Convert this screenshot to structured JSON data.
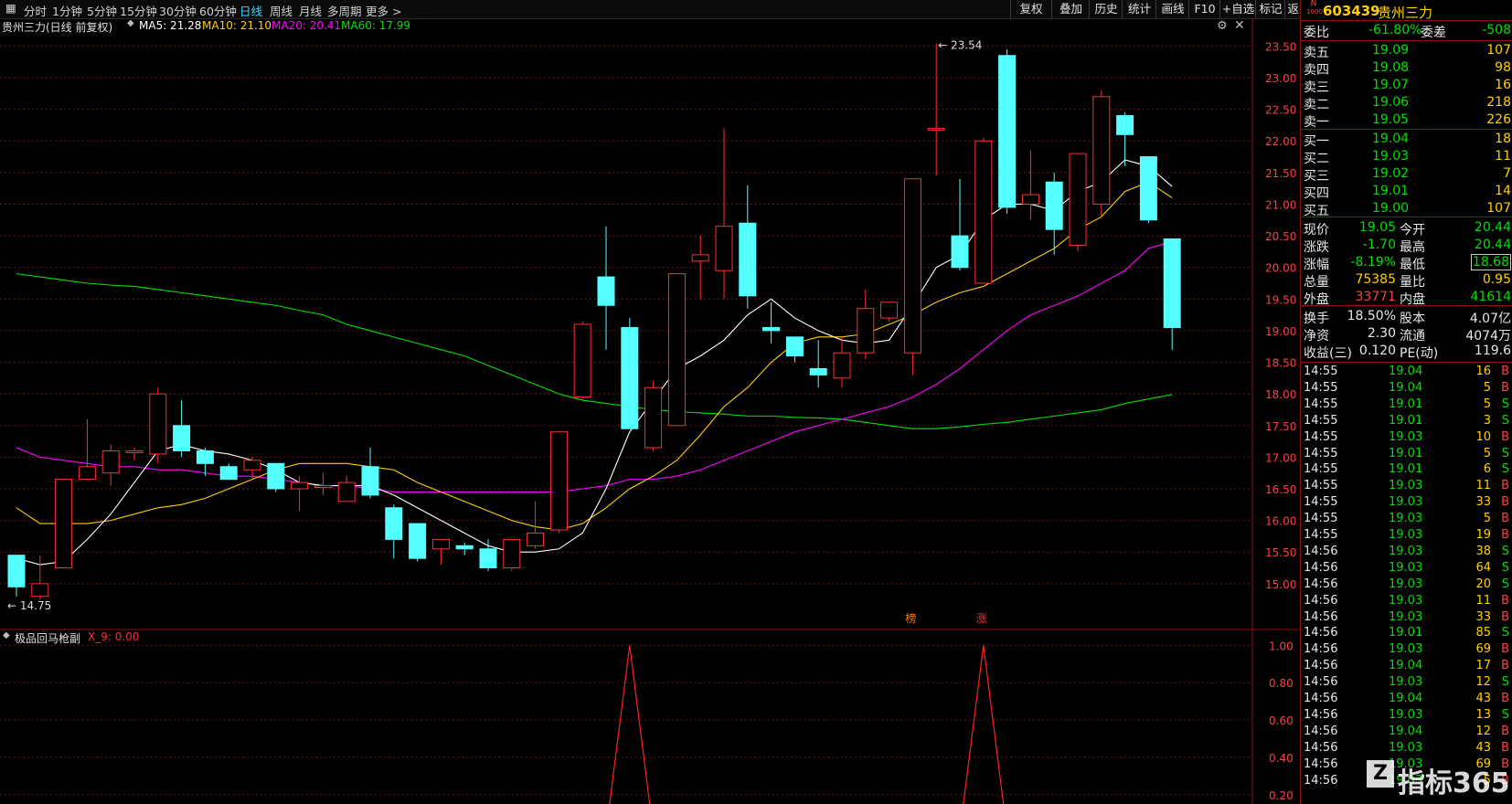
{
  "toolbar": {
    "items": [
      "分时",
      "1分钟",
      "5分钟",
      "15分钟",
      "30分钟",
      "60分钟",
      "日线",
      "周线",
      "月线",
      "多周期",
      "更多 >"
    ],
    "active_index": 6,
    "right_items": [
      "复权",
      "叠加",
      "历史",
      "统计",
      "画线",
      "F10",
      "+自选",
      "标记",
      "返回"
    ]
  },
  "info": {
    "title": "贵州三力(日线 前复权)",
    "ma5": "MA5: 21.28",
    "ma10": "MA10: 21.10",
    "ma20": "MA20: 20.41",
    "ma60": "MA60: 17.99",
    "colors": {
      "ma5": "#ffffff",
      "ma10": "#ffd000",
      "ma20": "#ff00ff",
      "ma60": "#00e000"
    }
  },
  "sub_info": {
    "title": "极品回马枪副",
    "value": "X_9: 0.00"
  },
  "chart_data": [
    {
      "type": "candlestick",
      "ylim": [
        14.55,
        23.65
      ],
      "y_ticks": [
        "15.00",
        "15.50",
        "16.00",
        "16.50",
        "17.00",
        "17.50",
        "18.00",
        "18.50",
        "19.00",
        "19.50",
        "20.00",
        "20.50",
        "21.00",
        "21.50",
        "22.00",
        "22.50",
        "23.00",
        "23.50"
      ],
      "annotations": {
        "high": "23.54",
        "low": "14.75",
        "markers": [
          "榜",
          "涨"
        ]
      },
      "candles": [
        {
          "o": 15.45,
          "h": 15.45,
          "l": 14.8,
          "c": 14.95
        },
        {
          "o": 14.8,
          "h": 15.45,
          "l": 14.75,
          "c": 15.0
        },
        {
          "o": 15.25,
          "h": 16.65,
          "l": 15.25,
          "c": 16.65
        },
        {
          "o": 16.65,
          "h": 17.6,
          "l": 16.65,
          "c": 16.85
        },
        {
          "o": 16.75,
          "h": 17.2,
          "l": 16.55,
          "c": 17.1
        },
        {
          "o": 17.1,
          "h": 17.15,
          "l": 16.95,
          "c": 17.1
        },
        {
          "o": 17.05,
          "h": 18.1,
          "l": 16.9,
          "c": 18.0
        },
        {
          "o": 17.5,
          "h": 17.9,
          "l": 17.0,
          "c": 17.1
        },
        {
          "o": 17.1,
          "h": 17.15,
          "l": 16.7,
          "c": 16.9
        },
        {
          "o": 16.85,
          "h": 16.9,
          "l": 16.65,
          "c": 16.65
        },
        {
          "o": 16.8,
          "h": 17.0,
          "l": 16.65,
          "c": 16.95
        },
        {
          "o": 16.9,
          "h": 16.9,
          "l": 16.45,
          "c": 16.5
        },
        {
          "o": 16.5,
          "h": 16.7,
          "l": 16.15,
          "c": 16.6
        },
        {
          "o": 16.55,
          "h": 16.75,
          "l": 16.4,
          "c": 16.55
        },
        {
          "o": 16.3,
          "h": 16.7,
          "l": 16.3,
          "c": 16.6
        },
        {
          "o": 16.85,
          "h": 17.15,
          "l": 16.35,
          "c": 16.4
        },
        {
          "o": 16.2,
          "h": 16.25,
          "l": 15.4,
          "c": 15.7
        },
        {
          "o": 15.95,
          "h": 15.95,
          "l": 15.35,
          "c": 15.4
        },
        {
          "o": 15.55,
          "h": 15.7,
          "l": 15.3,
          "c": 15.7
        },
        {
          "o": 15.6,
          "h": 15.65,
          "l": 15.45,
          "c": 15.55
        },
        {
          "o": 15.55,
          "h": 15.7,
          "l": 15.2,
          "c": 15.25
        },
        {
          "o": 15.25,
          "h": 15.7,
          "l": 15.2,
          "c": 15.7
        },
        {
          "o": 15.6,
          "h": 16.3,
          "l": 15.55,
          "c": 15.8
        },
        {
          "o": 15.85,
          "h": 17.4,
          "l": 15.8,
          "c": 17.4
        },
        {
          "o": 17.95,
          "h": 19.15,
          "l": 17.9,
          "c": 19.1
        },
        {
          "o": 19.85,
          "h": 20.65,
          "l": 18.7,
          "c": 19.4
        },
        {
          "o": 19.05,
          "h": 19.2,
          "l": 17.45,
          "c": 17.45
        },
        {
          "o": 17.15,
          "h": 18.2,
          "l": 17.1,
          "c": 18.1
        },
        {
          "o": 17.5,
          "h": 19.9,
          "l": 17.5,
          "c": 19.9
        },
        {
          "o": 20.1,
          "h": 20.5,
          "l": 19.5,
          "c": 20.2
        },
        {
          "o": 19.95,
          "h": 22.2,
          "l": 19.5,
          "c": 20.65
        },
        {
          "o": 20.7,
          "h": 21.3,
          "l": 19.35,
          "c": 19.55
        },
        {
          "o": 19.05,
          "h": 19.45,
          "l": 18.8,
          "c": 19.0
        },
        {
          "o": 18.9,
          "h": 18.9,
          "l": 18.5,
          "c": 18.6
        },
        {
          "o": 18.4,
          "h": 18.85,
          "l": 18.1,
          "c": 18.3
        },
        {
          "o": 18.25,
          "h": 18.9,
          "l": 18.1,
          "c": 18.65
        },
        {
          "o": 18.65,
          "h": 19.65,
          "l": 18.55,
          "c": 19.35
        },
        {
          "o": 19.2,
          "h": 19.45,
          "l": 19.15,
          "c": 19.45
        },
        {
          "o": 18.65,
          "h": 20.5,
          "l": 18.3,
          "c": 21.4
        },
        {
          "o": 22.2,
          "h": 23.54,
          "l": 21.45,
          "c": 22.2
        },
        {
          "o": 20.5,
          "h": 21.4,
          "l": 19.95,
          "c": 20.0
        },
        {
          "o": 19.75,
          "h": 22.05,
          "l": 19.75,
          "c": 22.0
        },
        {
          "o": 23.35,
          "h": 23.45,
          "l": 20.85,
          "c": 20.95
        },
        {
          "o": 21.0,
          "h": 21.85,
          "l": 20.75,
          "c": 21.15
        },
        {
          "o": 21.35,
          "h": 21.5,
          "l": 20.2,
          "c": 20.6
        },
        {
          "o": 20.35,
          "h": 21.75,
          "l": 20.25,
          "c": 21.8
        },
        {
          "o": 21.0,
          "h": 22.8,
          "l": 20.8,
          "c": 22.7
        },
        {
          "o": 22.4,
          "h": 22.45,
          "l": 21.6,
          "c": 22.1
        },
        {
          "o": 21.75,
          "h": 21.75,
          "l": 20.7,
          "c": 20.75
        },
        {
          "o": 20.45,
          "h": 20.45,
          "l": 18.7,
          "c": 19.05
        }
      ],
      "ma5": [
        15.4,
        15.3,
        15.35,
        15.7,
        16.1,
        16.6,
        17.1,
        17.2,
        17.1,
        17.05,
        16.95,
        16.8,
        16.6,
        16.55,
        16.55,
        16.55,
        16.4,
        16.2,
        16.0,
        15.8,
        15.6,
        15.5,
        15.5,
        15.55,
        15.8,
        16.5,
        17.4,
        17.9,
        18.4,
        18.6,
        18.85,
        19.25,
        19.5,
        19.2,
        19.0,
        18.85,
        18.8,
        18.85,
        19.4,
        20.0,
        20.2,
        20.75,
        21.0,
        21.0,
        20.9,
        21.2,
        21.35,
        21.7,
        21.6,
        21.28
      ],
      "ma10": [
        16.2,
        15.95,
        15.95,
        15.95,
        16.0,
        16.1,
        16.2,
        16.25,
        16.35,
        16.5,
        16.65,
        16.8,
        16.9,
        16.9,
        16.9,
        16.85,
        16.8,
        16.6,
        16.45,
        16.3,
        16.15,
        16.0,
        15.9,
        15.85,
        15.95,
        16.2,
        16.5,
        16.7,
        16.95,
        17.35,
        17.8,
        18.1,
        18.5,
        18.8,
        18.9,
        18.9,
        18.95,
        19.1,
        19.25,
        19.45,
        19.6,
        19.7,
        19.9,
        20.1,
        20.3,
        20.6,
        20.8,
        21.2,
        21.35,
        21.1
      ],
      "ma20": [
        17.15,
        17.0,
        16.95,
        16.9,
        16.85,
        16.85,
        16.8,
        16.8,
        16.75,
        16.7,
        16.7,
        16.65,
        16.6,
        16.55,
        16.55,
        16.5,
        16.45,
        16.45,
        16.45,
        16.45,
        16.45,
        16.45,
        16.45,
        16.45,
        16.5,
        16.55,
        16.65,
        16.65,
        16.7,
        16.8,
        16.95,
        17.1,
        17.25,
        17.4,
        17.5,
        17.6,
        17.7,
        17.8,
        17.95,
        18.15,
        18.4,
        18.7,
        19.0,
        19.25,
        19.4,
        19.55,
        19.75,
        19.95,
        20.3,
        20.41
      ],
      "ma60": [
        19.9,
        19.85,
        19.8,
        19.75,
        19.72,
        19.7,
        19.65,
        19.6,
        19.55,
        19.5,
        19.45,
        19.4,
        19.32,
        19.25,
        19.1,
        19.0,
        18.9,
        18.8,
        18.7,
        18.6,
        18.45,
        18.3,
        18.15,
        18.0,
        17.9,
        17.85,
        17.8,
        17.75,
        17.72,
        17.7,
        17.68,
        17.65,
        17.65,
        17.63,
        17.62,
        17.6,
        17.55,
        17.5,
        17.45,
        17.45,
        17.48,
        17.52,
        17.55,
        17.6,
        17.65,
        17.7,
        17.75,
        17.85,
        17.92,
        17.99
      ]
    },
    {
      "type": "line",
      "ylim": [
        0.15,
        1.08
      ],
      "y_ticks": [
        "0.20",
        "0.40",
        "0.60",
        "0.80",
        "1.00"
      ],
      "values": [
        0,
        0,
        0,
        0,
        0,
        0,
        0,
        0,
        0,
        0,
        0,
        0,
        0,
        0,
        0,
        0,
        0,
        0,
        0,
        0,
        0,
        0,
        0,
        0,
        0,
        0,
        1,
        0,
        0,
        0,
        0,
        0,
        0,
        0,
        0,
        0,
        0,
        0,
        0,
        0,
        0,
        1,
        0,
        0,
        0,
        0,
        0,
        0,
        0,
        0
      ]
    }
  ],
  "quote": {
    "code": "603439",
    "name": "贵州三力",
    "badge_top": "N",
    "badge_bottom": "1000",
    "weibi": {
      "label": "委比",
      "value": "-61.80%",
      "label2": "委差",
      "value2": "-508"
    },
    "sells": [
      {
        "label": "卖五",
        "price": "19.09",
        "vol": "107"
      },
      {
        "label": "卖四",
        "price": "19.08",
        "vol": "98"
      },
      {
        "label": "卖三",
        "price": "19.07",
        "vol": "16"
      },
      {
        "label": "卖二",
        "price": "19.06",
        "vol": "218"
      },
      {
        "label": "卖一",
        "price": "19.05",
        "vol": "226"
      }
    ],
    "buys": [
      {
        "label": "买一",
        "price": "19.04",
        "vol": "18"
      },
      {
        "label": "买二",
        "price": "19.03",
        "vol": "11"
      },
      {
        "label": "买三",
        "price": "19.02",
        "vol": "7"
      },
      {
        "label": "买四",
        "price": "19.01",
        "vol": "14"
      },
      {
        "label": "买五",
        "price": "19.00",
        "vol": "107"
      }
    ],
    "stats": [
      {
        "l1": "现价",
        "v1": "19.05",
        "l2": "今开",
        "v2": "20.44",
        "c1": "green",
        "c2": "green"
      },
      {
        "l1": "涨跌",
        "v1": "-1.70",
        "l2": "最高",
        "v2": "20.44",
        "c1": "green",
        "c2": "green"
      },
      {
        "l1": "涨幅",
        "v1": "-8.19%",
        "l2": "最低",
        "v2": "18.68",
        "c1": "green",
        "c2": "green"
      },
      {
        "l1": "总量",
        "v1": "75385",
        "l2": "量比",
        "v2": "0.95",
        "c1": "yellow",
        "c2": "yellow"
      },
      {
        "l1": "外盘",
        "v1": "33771",
        "l2": "内盘",
        "v2": "41614",
        "c1": "red",
        "c2": "green"
      }
    ],
    "stats2": [
      {
        "l1": "换手",
        "v1": "18.50%",
        "l2": "股本",
        "v2": "4.07亿"
      },
      {
        "l1": "净资",
        "v1": "2.30",
        "l2": "流通",
        "v2": "4074万"
      },
      {
        "l1": "收益(三)",
        "v1": "0.120",
        "l2": "PE(动)",
        "v2": "119.6"
      }
    ],
    "ticks": [
      {
        "t": "14:55",
        "p": "19.04",
        "v": "16",
        "s": "B"
      },
      {
        "t": "14:55",
        "p": "19.04",
        "v": "5",
        "s": "B"
      },
      {
        "t": "14:55",
        "p": "19.01",
        "v": "5",
        "s": "S"
      },
      {
        "t": "14:55",
        "p": "19.01",
        "v": "3",
        "s": "S"
      },
      {
        "t": "14:55",
        "p": "19.03",
        "v": "10",
        "s": "B"
      },
      {
        "t": "14:55",
        "p": "19.01",
        "v": "5",
        "s": "S"
      },
      {
        "t": "14:55",
        "p": "19.01",
        "v": "6",
        "s": "S"
      },
      {
        "t": "14:55",
        "p": "19.03",
        "v": "11",
        "s": "B"
      },
      {
        "t": "14:55",
        "p": "19.03",
        "v": "33",
        "s": "B"
      },
      {
        "t": "14:55",
        "p": "19.03",
        "v": "5",
        "s": "B"
      },
      {
        "t": "14:55",
        "p": "19.03",
        "v": "19",
        "s": "B"
      },
      {
        "t": "14:56",
        "p": "19.03",
        "v": "38",
        "s": "S"
      },
      {
        "t": "14:56",
        "p": "19.03",
        "v": "64",
        "s": "S"
      },
      {
        "t": "14:56",
        "p": "19.03",
        "v": "20",
        "s": "S"
      },
      {
        "t": "14:56",
        "p": "19.03",
        "v": "11",
        "s": "B"
      },
      {
        "t": "14:56",
        "p": "19.03",
        "v": "33",
        "s": "B"
      },
      {
        "t": "14:56",
        "p": "19.01",
        "v": "85",
        "s": "S"
      },
      {
        "t": "14:56",
        "p": "19.03",
        "v": "69",
        "s": "B"
      },
      {
        "t": "14:56",
        "p": "19.04",
        "v": "17",
        "s": "B"
      },
      {
        "t": "14:56",
        "p": "19.03",
        "v": "12",
        "s": "S"
      },
      {
        "t": "14:56",
        "p": "19.04",
        "v": "43",
        "s": "B"
      },
      {
        "t": "14:56",
        "p": "19.03",
        "v": "13",
        "s": "S"
      },
      {
        "t": "14:56",
        "p": "19.04",
        "v": "12",
        "s": "B"
      },
      {
        "t": "14:56",
        "p": "19.03",
        "v": "43",
        "s": "B"
      },
      {
        "t": "14:56",
        "p": "19.03",
        "v": "69",
        "s": "B"
      },
      {
        "t": "14:56",
        "p": "19.03",
        "v": "5",
        "s": "B"
      }
    ]
  },
  "watermark": {
    "logo": "Z",
    "text": "指标365"
  }
}
